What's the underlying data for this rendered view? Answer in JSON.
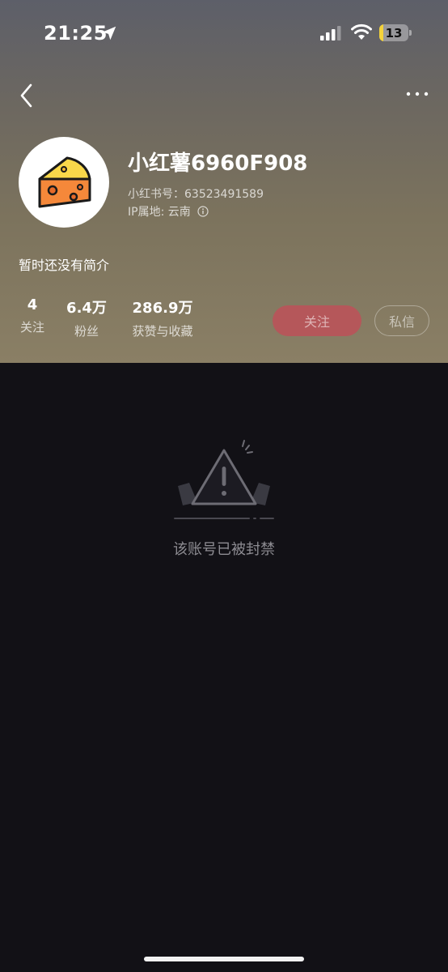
{
  "status_bar": {
    "time": "21:25",
    "battery_level": "13",
    "battery_color": "#f4d33a",
    "icons": [
      "location-arrow-icon",
      "signal-icon",
      "wifi-icon",
      "battery-icon"
    ]
  },
  "nav": {
    "back_icon": "chevron-left-icon",
    "more_icon": "more-dots-icon"
  },
  "profile": {
    "avatar_icon": "cheese-icon",
    "username": "小红薯6960F908",
    "id_text": "小红书号：63523491589",
    "ip_text": "IP属地: 云南",
    "bio": "暂时还没有简介"
  },
  "stats": {
    "following_value": "4",
    "following_label": "关注",
    "fans_value": "6.4万",
    "fans_label": "粉丝",
    "likes_value": "286.9万",
    "likes_label": "获赞与收藏"
  },
  "actions": {
    "follow_label": "关注",
    "message_label": "私信",
    "follow_color": "#b5575a"
  },
  "content": {
    "banned_icon": "warning-triangle-icon",
    "banned_text": "该账号已被封禁"
  }
}
